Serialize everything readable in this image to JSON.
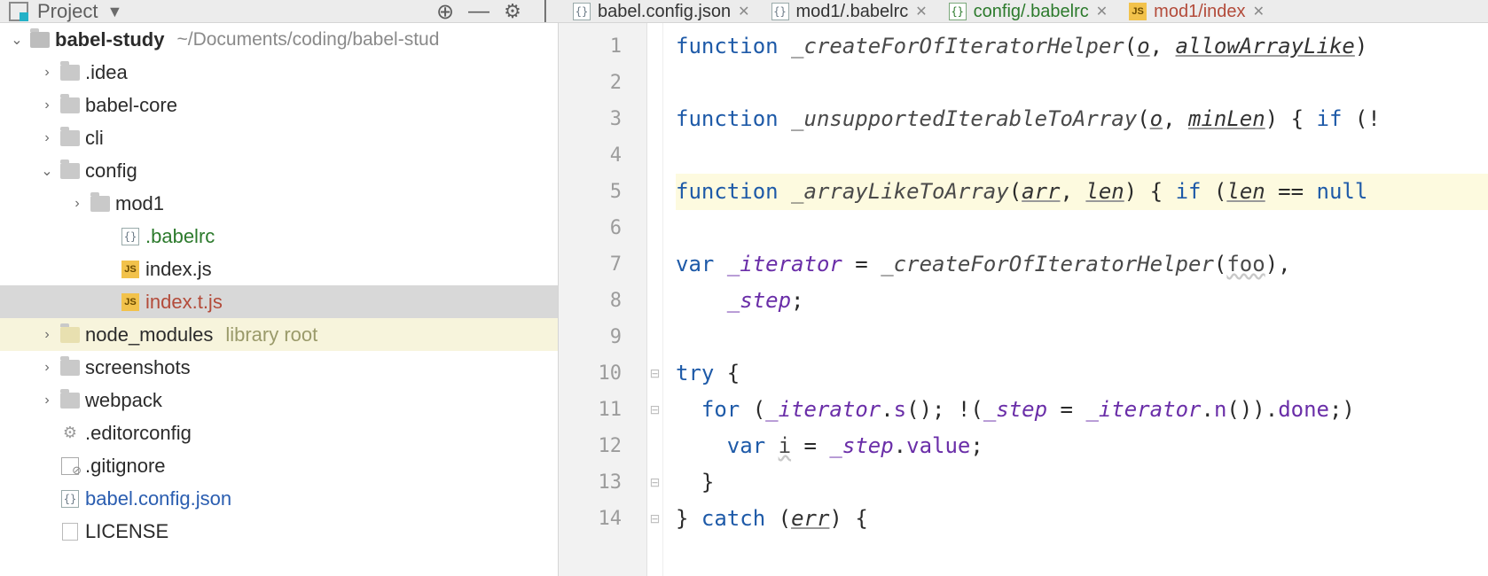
{
  "toolbar": {
    "project_label": "Project"
  },
  "tabs": [
    {
      "icon": "braces",
      "name": "babel.config.json",
      "cls": ""
    },
    {
      "icon": "braces",
      "name": "mod1/.babelrc",
      "cls": ""
    },
    {
      "icon": "braces-green",
      "name": "config/.babelrc",
      "cls": "green"
    },
    {
      "icon": "js",
      "name": "mod1/index",
      "cls": "red"
    }
  ],
  "tree": {
    "root_name": "babel-study",
    "root_path": "~/Documents/coding/babel-stud",
    "items": [
      {
        "indent": 1,
        "arrow": ">",
        "icon": "folder",
        "name": ".idea"
      },
      {
        "indent": 1,
        "arrow": ">",
        "icon": "folder",
        "name": "babel-core"
      },
      {
        "indent": 1,
        "arrow": ">",
        "icon": "folder",
        "name": "cli"
      },
      {
        "indent": 1,
        "arrow": "v",
        "icon": "folder",
        "name": "config"
      },
      {
        "indent": 2,
        "arrow": ">",
        "icon": "folder",
        "name": "mod1"
      },
      {
        "indent": 3,
        "arrow": "",
        "icon": "braces",
        "name": ".babelrc",
        "cls": "green"
      },
      {
        "indent": 3,
        "arrow": "",
        "icon": "js",
        "name": "index.js"
      },
      {
        "indent": 3,
        "arrow": "",
        "icon": "js",
        "name": "index.t.js",
        "cls": "orange",
        "selected": true
      },
      {
        "indent": 1,
        "arrow": ">",
        "icon": "folder-lib",
        "name": "node_modules",
        "suffix": "library root",
        "lib": true
      },
      {
        "indent": 1,
        "arrow": ">",
        "icon": "folder",
        "name": "screenshots"
      },
      {
        "indent": 1,
        "arrow": ">",
        "icon": "folder",
        "name": "webpack"
      },
      {
        "indent": 1,
        "arrow": "",
        "icon": "gear",
        "name": ".editorconfig"
      },
      {
        "indent": 1,
        "arrow": "",
        "icon": "ignore",
        "name": ".gitignore"
      },
      {
        "indent": 1,
        "arrow": "",
        "icon": "braces",
        "name": "babel.config.json",
        "cls": "link"
      },
      {
        "indent": 1,
        "arrow": "",
        "icon": "file",
        "name": "LICENSE"
      }
    ]
  },
  "editor": {
    "lines": [
      {
        "n": 1,
        "html": "<span class='kw'>function</span> <span class='fnname'>_createForOfIteratorHelper</span>(<span class='param'>o</span>, <span class='param'>allowArrayLike</span>)"
      },
      {
        "n": 2,
        "html": ""
      },
      {
        "n": 3,
        "html": "<span class='kw'>function</span> <span class='fnname'>_unsupportedIterableToArray</span>(<span class='param'>o</span>, <span class='param'>minLen</span>) { <span class='kw'>if</span> (!"
      },
      {
        "n": 4,
        "html": ""
      },
      {
        "n": 5,
        "hl": true,
        "html": "<span class='kw'>function</span> <span class='fnname'>_arrayLikeToArray</span>(<span class='param'>arr</span>, <span class='param'>len</span>) { <span class='kw'>if</span> (<span class='param'>len</span> == <span class='nullk'>null</span>"
      },
      {
        "n": 6,
        "html": ""
      },
      {
        "n": 7,
        "html": "<span class='kw'>var</span> <span class='id'>_iterator</span> = <span class='fnname'>_createForOfIteratorHelper</span>(<span class='lvar'>foo</span>),"
      },
      {
        "n": 8,
        "html": "    <span class='id'>_step</span>;"
      },
      {
        "n": 9,
        "html": ""
      },
      {
        "n": 10,
        "fold": "-",
        "html": "<span class='kw'>try</span> {"
      },
      {
        "n": 11,
        "fold": "-",
        "html": "  <span class='kw'>for</span> (<span class='id'>_iterator</span>.<span class='prop'>s</span>(); !(<span class='id'>_step</span> = <span class='id'>_iterator</span>.<span class='prop'>n</span>()).<span class='prop'>done</span>;) "
      },
      {
        "n": 12,
        "html": "    <span class='kw'>var</span> <span class='lvar'>i</span> = <span class='id'>_step</span>.<span class='prop'>value</span>;"
      },
      {
        "n": 13,
        "fold": "-",
        "html": "  }"
      },
      {
        "n": 14,
        "fold": "-",
        "html": "} <span class='kw'>catch</span> (<span class='param'>err</span>) {"
      }
    ]
  }
}
